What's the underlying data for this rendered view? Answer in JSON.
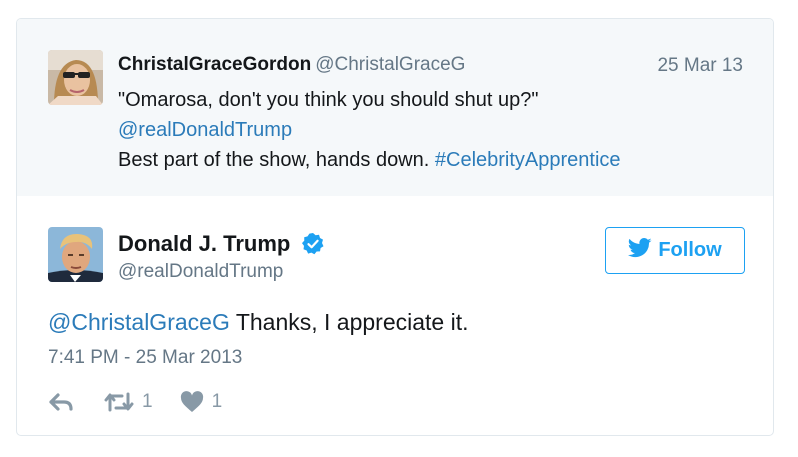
{
  "quoted_tweet": {
    "display_name": "ChristalGraceGordon",
    "handle": "@ChristalGraceG",
    "date": "25 Mar 13",
    "line1": "\"Omarosa, don't you think you should shut up?\"",
    "mention": "@realDonaldTrump",
    "line3_text": "Best part of the show, hands down. ",
    "hashtag": "#CelebrityApprentice"
  },
  "main_tweet": {
    "display_name": "Donald J. Trump",
    "handle": "@realDonaldTrump",
    "follow_label": "Follow",
    "reply_mention": "@ChristalGraceG",
    "text": " Thanks, I appreciate it.",
    "timestamp": "7:41 PM - 25 Mar 2013",
    "retweet_count": "1",
    "like_count": "1"
  },
  "colors": {
    "link": "#2b7bb9",
    "twitter_blue": "#1da1f2",
    "muted": "#657786",
    "quoted_bg": "#f5f8fa"
  },
  "icons": [
    "reply-icon",
    "retweet-icon",
    "heart-icon",
    "twitter-bird-icon",
    "verified-badge-icon"
  ]
}
